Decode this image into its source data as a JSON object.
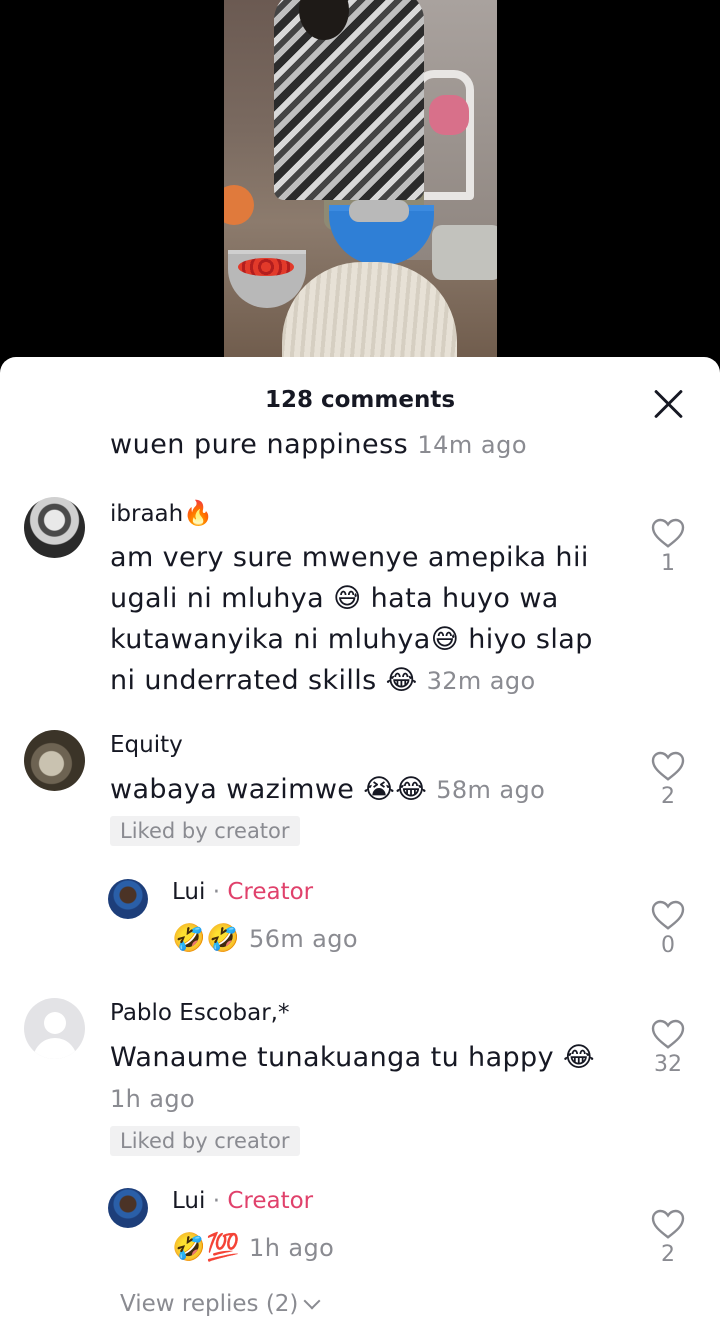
{
  "sheet": {
    "comment_count": "128 comments",
    "close_icon": "close-icon"
  },
  "partial": {
    "text": "wuen pure nappiness",
    "time": "14m ago"
  },
  "comments": [
    {
      "username": "ibraah",
      "username_emoji": "🔥",
      "lines": [
        "am very sure mwenye amepika hii",
        "ugali ni mluhya 😅 hata huyo wa",
        "kutawanyika ni mluhya😅 hiyo slap",
        "ni underrated skills 😂"
      ],
      "time": "32m ago",
      "likes": "1"
    },
    {
      "username": "Equity",
      "text": "wabaya wazimwe 😭😂",
      "time": "58m ago",
      "liked_by": "Liked by creator",
      "likes": "2"
    },
    {
      "username": "Lui",
      "sep": "·",
      "creator": "Creator",
      "text": "🤣🤣",
      "time": "56m ago",
      "likes": "0"
    },
    {
      "username": "Pablo Escobar,*",
      "text": "Wanaume tunakuanga tu happy 😂",
      "time": "1h ago",
      "liked_by": "Liked by creator",
      "likes": "32"
    },
    {
      "username": "Lui",
      "sep": "·",
      "creator": "Creator",
      "text": "🤣💯",
      "time": "1h ago",
      "likes": "2"
    }
  ],
  "view_replies": "View replies (2)",
  "colors": {
    "accent": "#e0416b",
    "muted": "#8a8b91",
    "text": "#161823"
  }
}
